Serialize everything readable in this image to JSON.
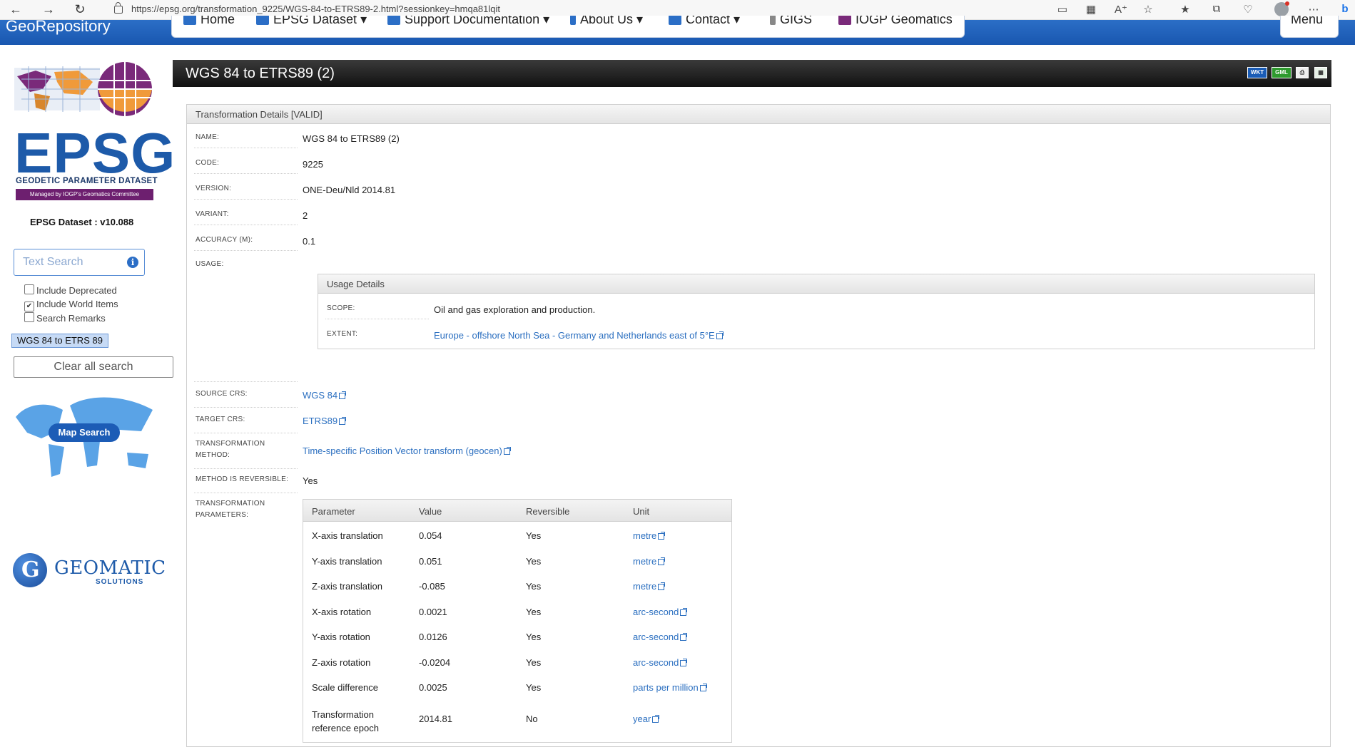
{
  "browser": {
    "url": "https://epsg.org/transformation_9225/WGS-84-to-ETRS89-2.html?sessionkey=hmqa81lqit"
  },
  "site_nav": {
    "brand": "GeoRepository",
    "items": [
      {
        "label": "Home"
      },
      {
        "label": "EPSG Dataset"
      },
      {
        "label": "Support Documentation"
      },
      {
        "label": "About Us"
      },
      {
        "label": "Contact"
      },
      {
        "label": "GIGS"
      },
      {
        "label": "IOGP Geomatics"
      }
    ],
    "menu_label": "Menu"
  },
  "sidebar": {
    "logo_title": "EPSG",
    "logo_subtitle": "GEODETIC PARAMETER DATASET",
    "logo_managed": "Managed by IOGP's Geomatics Committee",
    "dataset_label": "EPSG Dataset :  v10.088",
    "search_placeholder": "Text Search",
    "checkboxes": [
      {
        "label": "Include Deprecated",
        "checked": false
      },
      {
        "label": "Include World Items",
        "checked": true
      },
      {
        "label": "Search Remarks",
        "checked": false
      }
    ],
    "active_search": "WGS 84 to ETRS 89",
    "clear_label": "Clear all search",
    "map_search_label": "Map Search",
    "geomatic_name": "GEOMATIC",
    "geomatic_sub": "SOLUTIONS"
  },
  "main": {
    "title": "WGS 84 to ETRS89 (2)",
    "toolbar": {
      "wkt": "WKT",
      "gml": "GML"
    },
    "panel_title": "Transformation Details [VALID]",
    "fields": {
      "name_label": "NAME:",
      "name": "WGS 84 to ETRS89 (2)",
      "code_label": "CODE:",
      "code": "9225",
      "version_label": "VERSION:",
      "version": "ONE-Deu/Nld 2014.81",
      "variant_label": "VARIANT:",
      "variant": "2",
      "accuracy_label": "ACCURACY (M):",
      "accuracy": "0.1",
      "usage_label": "USAGE:",
      "source_crs_label": "SOURCE CRS:",
      "source_crs": "WGS 84",
      "target_crs_label": "TARGET CRS:",
      "target_crs": "ETRS89",
      "method_label_1": "TRANSFORMATION",
      "method_label_2": "METHOD:",
      "method": "Time-specific Position Vector transform (geocen)",
      "reversible_label": "METHOD IS REVERSIBLE:",
      "reversible": "Yes",
      "params_label_1": "TRANSFORMATION",
      "params_label_2": "PARAMETERS:"
    },
    "usage": {
      "title": "Usage Details",
      "scope_label": "SCOPE:",
      "scope": "Oil and gas exploration and production.",
      "extent_label": "EXTENT:",
      "extent": "Europe - offshore North Sea - Germany and Netherlands east of 5°E"
    },
    "params": {
      "headers": [
        "Parameter",
        "Value",
        "Reversible",
        "Unit"
      ],
      "rows": [
        {
          "parameter": "X-axis translation",
          "value": "0.054",
          "reversible": "Yes",
          "unit": "metre"
        },
        {
          "parameter": "Y-axis translation",
          "value": "0.051",
          "reversible": "Yes",
          "unit": "metre"
        },
        {
          "parameter": "Z-axis translation",
          "value": "-0.085",
          "reversible": "Yes",
          "unit": "metre"
        },
        {
          "parameter": "X-axis rotation",
          "value": "0.0021",
          "reversible": "Yes",
          "unit": "arc-second"
        },
        {
          "parameter": "Y-axis rotation",
          "value": "0.0126",
          "reversible": "Yes",
          "unit": "arc-second"
        },
        {
          "parameter": "Z-axis rotation",
          "value": "-0.0204",
          "reversible": "Yes",
          "unit": "arc-second"
        },
        {
          "parameter": "Scale difference",
          "value": "0.0025",
          "reversible": "Yes",
          "unit": "parts per million"
        },
        {
          "parameter": "Transformation reference epoch",
          "parameter_line1": "Transformation",
          "parameter_line2": "reference epoch",
          "value": "2014.81",
          "reversible": "No",
          "unit": "year"
        }
      ]
    }
  },
  "colors": {
    "brand_blue": "#1d5aa9",
    "link": "#2b6fc0",
    "title_bar": "#111111",
    "managed_purple": "#6d1f6f"
  }
}
